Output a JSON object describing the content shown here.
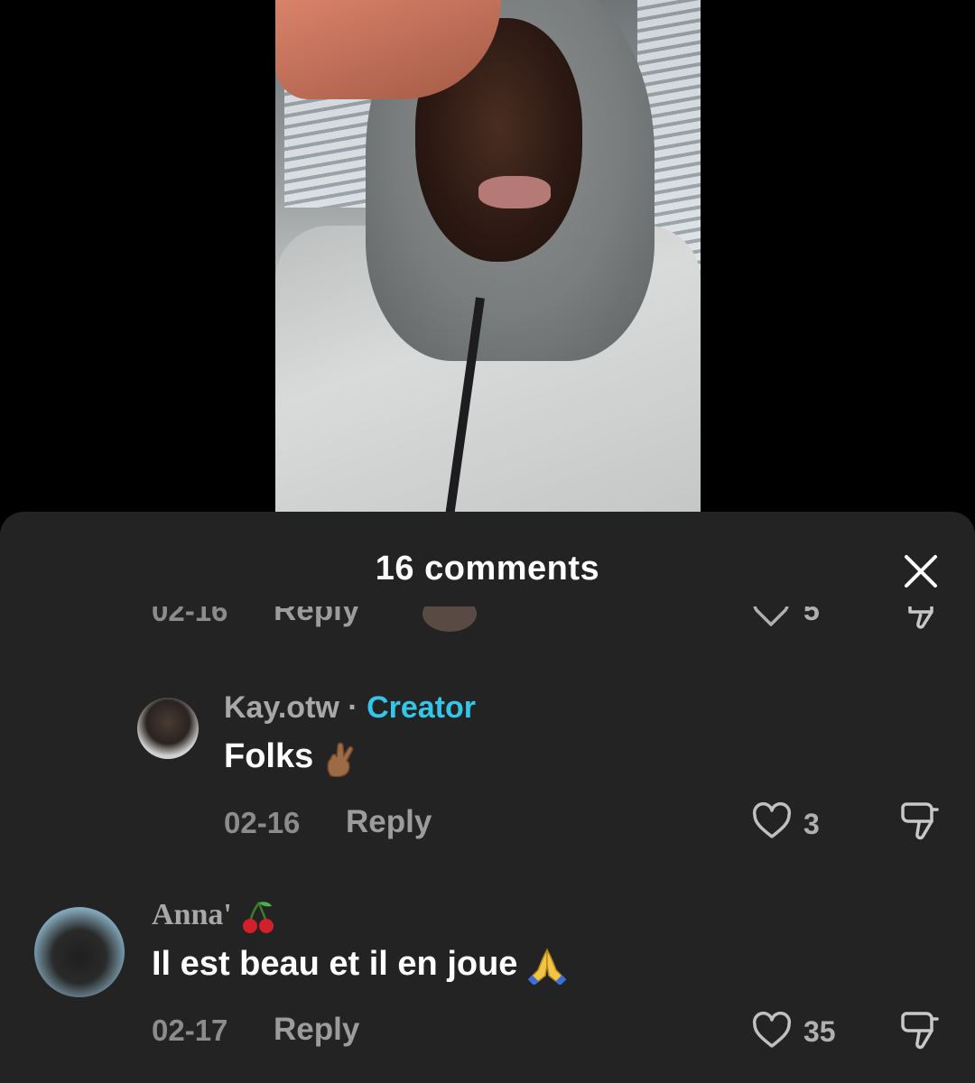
{
  "sheet": {
    "title": "16 comments"
  },
  "partial_row": {
    "date": "02-16",
    "reply": "Reply",
    "likes": "5"
  },
  "comments": [
    {
      "username": "Kay.otw",
      "separator": "·",
      "badge": "Creator",
      "text": "Folks",
      "emoji": "crossed-fingers",
      "date": "02-16",
      "reply": "Reply",
      "likes": "3"
    },
    {
      "username": "Anna'",
      "emoji_name": "cherries",
      "text": "Il est beau et il en joue",
      "emoji": "folded-hands",
      "date": "02-17",
      "reply": "Reply",
      "likes": "35"
    }
  ],
  "colors": {
    "sheet_bg": "#232323",
    "creator_badge": "#34c6e8",
    "muted_text": "#9c9c9c"
  }
}
